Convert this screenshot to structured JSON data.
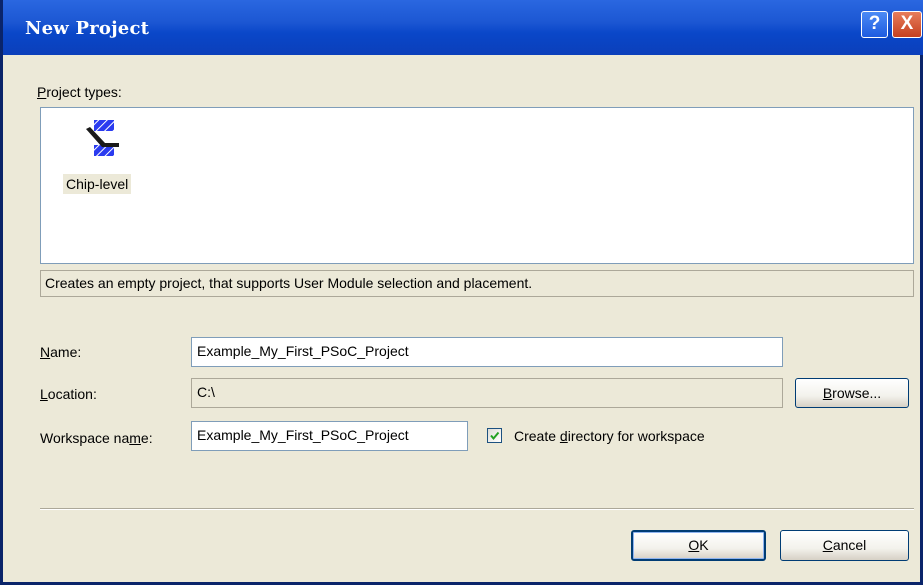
{
  "window": {
    "title": "New Project",
    "help_glyph": "?",
    "close_glyph": "X"
  },
  "project_types": {
    "label_underlined": "P",
    "label_rest": "roject types:",
    "items": [
      {
        "label": "Chip-level",
        "icon": "chip-level-icon",
        "selected": true
      }
    ],
    "description": "Creates an empty project, that supports User Module selection and placement."
  },
  "form": {
    "name": {
      "label_underlined": "N",
      "label_rest": "ame:",
      "value": "Example_My_First_PSoC_Project"
    },
    "location": {
      "label_underlined": "L",
      "label_rest": "ocation:",
      "value": "C:\\"
    },
    "workspace": {
      "label_pre": "Workspace na",
      "label_underlined": "m",
      "label_rest": "e:",
      "value": "Example_My_First_PSoC_Project"
    },
    "create_dir": {
      "label_pre": "Create ",
      "label_underlined": "d",
      "label_rest": "irectory for workspace",
      "checked": true
    }
  },
  "buttons": {
    "browse": {
      "underlined": "B",
      "rest": "rowse..."
    },
    "ok": {
      "underlined": "O",
      "rest": "K"
    },
    "cancel": {
      "underlined": "C",
      "rest": "ancel"
    }
  },
  "colors": {
    "titlebar": "#0a47c9",
    "dialog_bg": "#ece9d8",
    "field_border": "#7f9db9",
    "icon_blue": "#2a3bf0"
  }
}
